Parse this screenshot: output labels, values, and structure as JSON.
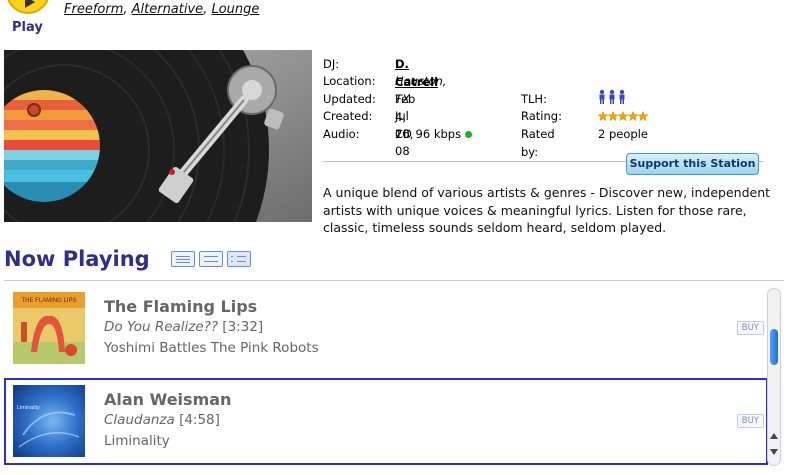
{
  "header": {
    "play_label": "Play",
    "genres": [
      "Freeform",
      "Alternative",
      "Lounge"
    ]
  },
  "station": {
    "dj_label": "DJ:",
    "dj": "D. Catrell",
    "location_label": "Location:",
    "location": "Houston, TX",
    "updated_label": "Updated:",
    "updated": "Feb 4, 10",
    "created_label": "Created:",
    "created": "Jul 26, 08",
    "audio_label": "Audio:",
    "audio": "CD 96 kbps",
    "tlh_label": "TLH:",
    "rating_label": "Rating:",
    "rating_stars": 5,
    "rated_by_label": "Rated by:",
    "rated_by": "2 people",
    "support_button": "Support this Station",
    "description": "A unique blend of various artists & genres - Discover new, independent artists with unique voices & meaningful lyrics. Listen for those rare, classic, timeless sounds seldom heard, seldom played."
  },
  "now_playing": {
    "title": "Now Playing",
    "tracks": [
      {
        "artist": "The Flaming Lips",
        "song": "Do You Realize??",
        "duration": "[3:32]",
        "album": "Yoshimi Battles The Pink Robots",
        "art_text": "THE FLAMING LIPS",
        "buy": "BUY"
      },
      {
        "artist": "Alan Weisman",
        "song": "Claudanza",
        "duration": "[4:58]",
        "album": "Liminality",
        "art_text": "Liminality",
        "buy": "BUY"
      }
    ]
  },
  "colors": {
    "heading": "#2e2e8f",
    "play_button": "#ffd21a",
    "selected_border": "#2e2ed0",
    "support_button": "#9fd2ec",
    "status_dot": "#1eb01e",
    "stars": "#f0a800"
  }
}
